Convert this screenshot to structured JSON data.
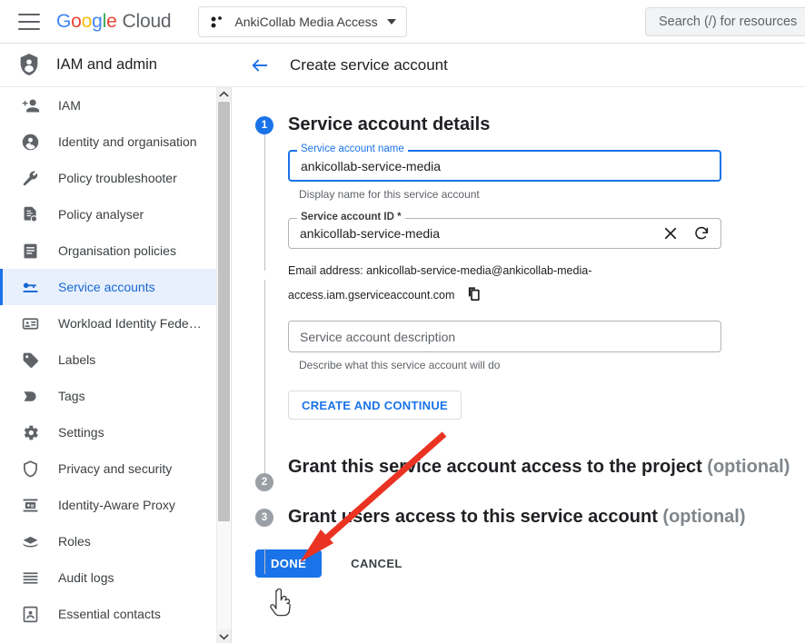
{
  "topbar": {
    "menu_icon": "hamburger-icon",
    "brand": {
      "g": "G",
      "o1": "o",
      "o2": "o",
      "g2": "g",
      "l": "l",
      "e": "e",
      "cloud": "Cloud"
    },
    "project_selector": {
      "label": "AnkiCollab Media Access",
      "icon": "project-icon",
      "caret": "chevron-down-icon"
    },
    "search": {
      "placeholder": "Search (/) for resources",
      "text": "Search (/) for resources"
    }
  },
  "product_header": {
    "title": "IAM and admin",
    "icon": "shield-person-icon"
  },
  "sidebar": {
    "items": [
      {
        "label": "IAM",
        "icon": "person-add-icon",
        "active": false
      },
      {
        "label": "Identity and organisation",
        "icon": "account-circle-icon",
        "active": false
      },
      {
        "label": "Policy troubleshooter",
        "icon": "wrench-icon",
        "active": false
      },
      {
        "label": "Policy analyser",
        "icon": "document-search-icon",
        "active": false
      },
      {
        "label": "Organisation policies",
        "icon": "list-document-icon",
        "active": false
      },
      {
        "label": "Service accounts",
        "icon": "key-card-icon",
        "active": true
      },
      {
        "label": "Workload Identity Federat…",
        "icon": "id-card-icon",
        "active": false
      },
      {
        "label": "Labels",
        "icon": "tag-icon",
        "active": false
      },
      {
        "label": "Tags",
        "icon": "flag-tag-icon",
        "active": false
      },
      {
        "label": "Settings",
        "icon": "gear-icon",
        "active": false
      },
      {
        "label": "Privacy and security",
        "icon": "shield-icon",
        "active": false
      },
      {
        "label": "Identity-Aware Proxy",
        "icon": "proxy-icon",
        "active": false
      },
      {
        "label": "Roles",
        "icon": "roles-hat-icon",
        "active": false
      },
      {
        "label": "Audit logs",
        "icon": "lines-icon",
        "active": false
      },
      {
        "label": "Essential contacts",
        "icon": "contact-card-icon",
        "active": false
      }
    ],
    "scrollbar": {
      "up_icon": "chevron-up-icon",
      "down_icon": "chevron-down-icon"
    }
  },
  "page": {
    "back_icon": "arrow-back-icon",
    "title": "Create service account"
  },
  "steps": [
    {
      "number": "1",
      "title": "Service account details",
      "optional": "",
      "state": "active"
    },
    {
      "number": "2",
      "title": "Grant this service account access to the project",
      "optional": "(optional)",
      "state": "inactive"
    },
    {
      "number": "3",
      "title": "Grant users access to this service account",
      "optional": "(optional)",
      "state": "inactive"
    }
  ],
  "form": {
    "name_field": {
      "label": "Service account name",
      "value": "ankicollab-service-media",
      "helper": "Display name for this service account"
    },
    "id_field": {
      "label": "Service account ID *",
      "value": "ankicollab-service-media",
      "clear_icon": "close-icon",
      "refresh_icon": "refresh-icon"
    },
    "email": {
      "line1": "Email address: ankicollab-service-media@ankicollab-media-",
      "line2": "access.iam.gserviceaccount.com",
      "copy_icon": "copy-icon"
    },
    "description_field": {
      "placeholder": "Service account description",
      "value": "",
      "helper": "Describe what this service account will do"
    },
    "create_continue_label": "CREATE AND CONTINUE"
  },
  "footer": {
    "done_label": "DONE",
    "cancel_label": "CANCEL"
  },
  "annotation": {
    "arrow_color": "#ea3323",
    "cursor": "pointer-hand-cursor"
  },
  "colors": {
    "accent_blue": "#1a73e8",
    "active_nav_bg": "#e8f0fe",
    "active_nav_text": "#1967d2",
    "gray_badge": "#9aa0a6",
    "body_text": "#202124",
    "muted_text": "#5f6368"
  }
}
